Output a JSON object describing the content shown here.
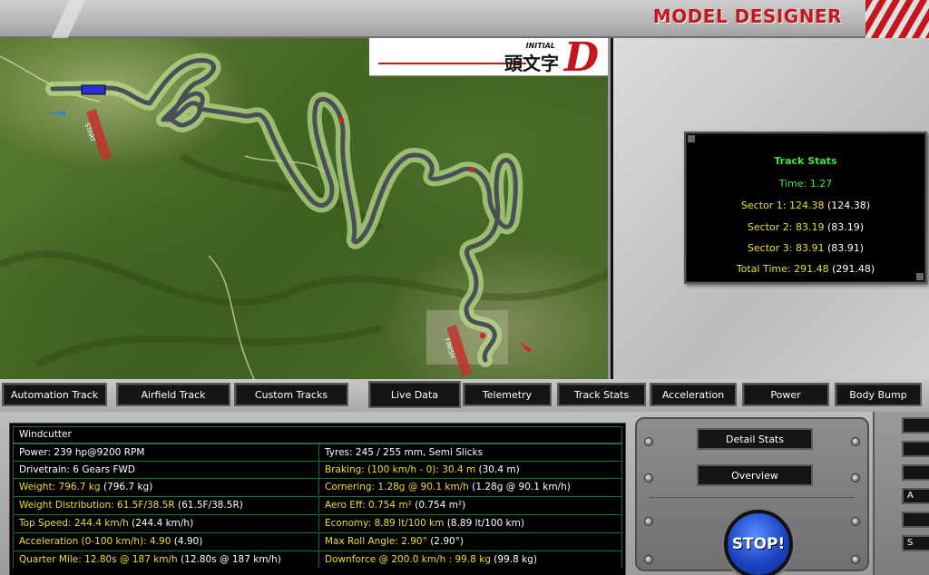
{
  "header": {
    "title": "MODEL DESIGNER"
  },
  "logo": {
    "top_text": "INITIAL",
    "kanji": "頭文字",
    "letter": "D"
  },
  "map": {
    "labels": [
      "START",
      "FINISH"
    ]
  },
  "track_stats": {
    "title": "Track Stats",
    "time": "Time: 1.27",
    "sectors": [
      {
        "label": "Sector 1: 124.38",
        "paren": "(124.38)"
      },
      {
        "label": "Sector 2: 83.19",
        "paren": "(83.19)"
      },
      {
        "label": "Sector 3: 83.91",
        "paren": "(83.91)"
      },
      {
        "label": "Total Time: 291.48",
        "paren": "(291.48)"
      }
    ]
  },
  "tabs": {
    "left": [
      "Automation Track",
      "Airfield Track",
      "Custom Tracks"
    ],
    "right": [
      "Live Data",
      "Telemetry",
      "Track Stats",
      "Acceleration",
      "Power",
      "Body Bump"
    ]
  },
  "car": {
    "name": "Windcutter",
    "left": [
      {
        "label": "Power: 239 hp@9200 RPM",
        "paren": "",
        "color": "white"
      },
      {
        "label": "Drivetrain: 6 Gears FWD",
        "paren": "",
        "color": "white"
      },
      {
        "label": "Weight: 796.7 kg",
        "paren": "(796.7 kg)",
        "color": "yellow"
      },
      {
        "label": "Weight Distribution: 61.5F/38.5R",
        "paren": "(61.5F/38.5R)",
        "color": "yellow"
      },
      {
        "label": "Top Speed: 244.4 km/h",
        "paren": "(244.4 km/h)",
        "color": "yellow"
      },
      {
        "label": "Acceleration (0-100 km/h): 4.90",
        "paren": "(4.90)",
        "color": "yellow"
      },
      {
        "label": "Quarter Mile: 12.80s @ 187 km/h",
        "paren": "(12.80s @ 187 km/h)",
        "color": "yellow"
      }
    ],
    "right": [
      {
        "label": "Tyres: 245 / 255 mm, Semi Slicks",
        "paren": "",
        "color": "white"
      },
      {
        "label": "Braking: (100 km/h - 0): 30.4 m",
        "paren": "(30.4 m)",
        "color": "yellow"
      },
      {
        "label": "Cornering: 1.28g @ 90.1 km/h",
        "paren": "(1.28g @ 90.1 km/h)",
        "color": "yellow"
      },
      {
        "label": "Aero Eff: 0.754 m²",
        "paren": "(0.754 m²)",
        "color": "yellow"
      },
      {
        "label": "Economy: 8.89 lt/100 km",
        "paren": "(8.89 lt/100 km)",
        "color": "yellow"
      },
      {
        "label": "Max Roll Angle: 2.90°",
        "paren": "(2.90°)",
        "color": "yellow"
      },
      {
        "label": "Downforce @ 200.0 km/h : 99.8 kg",
        "paren": "(99.8 kg)",
        "color": "yellow"
      }
    ]
  },
  "controls": {
    "detail_stats": "Detail Stats",
    "overview": "Overview",
    "stop": "STOP!"
  },
  "side_buttons": [
    "",
    "",
    "",
    "A",
    "",
    "S"
  ]
}
